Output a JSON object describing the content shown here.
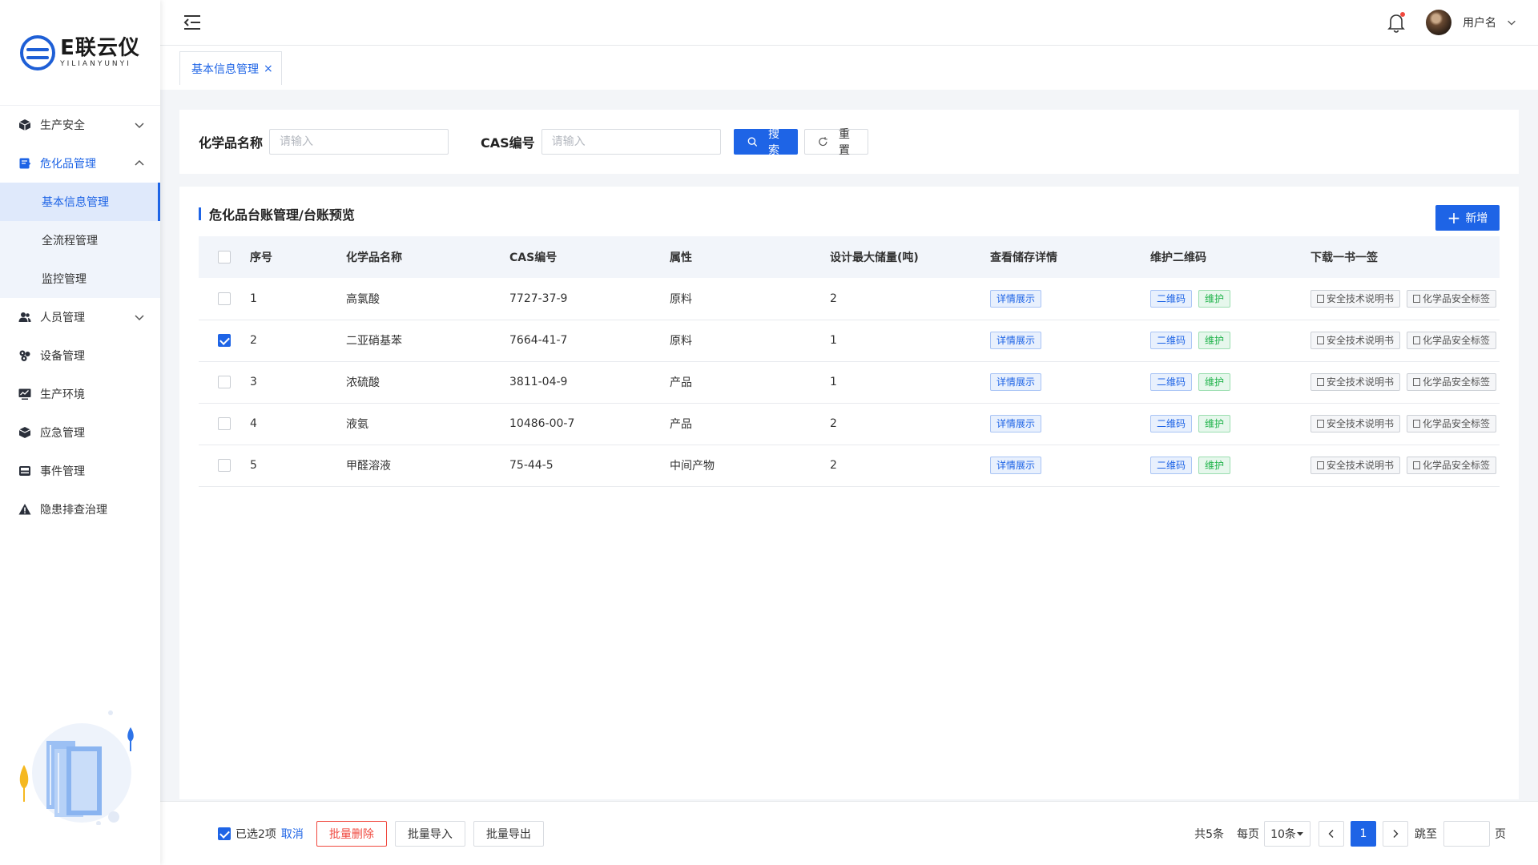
{
  "brand": {
    "name_cn": "E联云仪",
    "name_en": "YILIANYUNYI"
  },
  "sidebar": {
    "items": [
      {
        "label": "生产安全",
        "icon": "cube-icon",
        "expanded": false
      },
      {
        "label": "危化品管理",
        "icon": "document-edit-icon",
        "expanded": true,
        "children": [
          {
            "label": "基本信息管理",
            "active": true
          },
          {
            "label": "全流程管理",
            "active": false
          },
          {
            "label": "监控管理",
            "active": false
          }
        ]
      },
      {
        "label": "人员管理",
        "icon": "users-icon",
        "expanded": false
      },
      {
        "label": "设备管理",
        "icon": "devices-icon"
      },
      {
        "label": "生产环境",
        "icon": "monitor-chart-icon"
      },
      {
        "label": "应急管理",
        "icon": "box-icon"
      },
      {
        "label": "事件管理",
        "icon": "inbox-icon"
      },
      {
        "label": "隐患排查治理",
        "icon": "warning-icon"
      }
    ]
  },
  "header": {
    "username": "用户名"
  },
  "tabs": [
    {
      "label": "基本信息管理",
      "close": "×"
    }
  ],
  "search": {
    "name_label": "化学品名称",
    "name_placeholder": "请输入",
    "cas_label": "CAS编号",
    "cas_placeholder": "请输入",
    "search_btn": "搜索",
    "reset_btn": "重置"
  },
  "table": {
    "title": "危化品台账管理/台账预览",
    "add_btn": "新增",
    "columns": [
      "序号",
      "化学品名称",
      "CAS编号",
      "属性",
      "设计最大储量(吨)",
      "查看储存详情",
      "维护二维码",
      "下载一书一签"
    ],
    "actions": {
      "detail": "详情展示",
      "qrcode": "二维码",
      "maintain": "维护",
      "manual": "安全技术说明书",
      "label": "化学品安全标签"
    },
    "rows": [
      {
        "no": "1",
        "name": "高氯酸",
        "cas": "7727-37-9",
        "attr": "原料",
        "max": "2",
        "checked": false
      },
      {
        "no": "2",
        "name": "二亚硝基苯",
        "cas": "7664-41-7",
        "attr": "原料",
        "max": "1",
        "checked": true
      },
      {
        "no": "3",
        "name": "浓硫酸",
        "cas": "3811-04-9",
        "attr": "产品",
        "max": "1",
        "checked": false
      },
      {
        "no": "4",
        "name": "液氨",
        "cas": "10486-00-7",
        "attr": "产品",
        "max": "2",
        "checked": false
      },
      {
        "no": "5",
        "name": "甲醛溶液",
        "cas": "75-44-5",
        "attr": "中间产物",
        "max": "2",
        "checked": false
      }
    ]
  },
  "footer": {
    "selected_text": "已选2项",
    "cancel": "取消",
    "batch_delete": "批量删除",
    "batch_import": "批量导入",
    "batch_export": "批量导出",
    "total": "共5条",
    "per_page_label": "每页",
    "page_size": "10条",
    "current_page": "1",
    "jump_label": "跳至",
    "page_suffix": "页"
  },
  "colors": {
    "primary": "#1e64e6",
    "success": "#1fb34a",
    "danger": "#f0483e"
  }
}
